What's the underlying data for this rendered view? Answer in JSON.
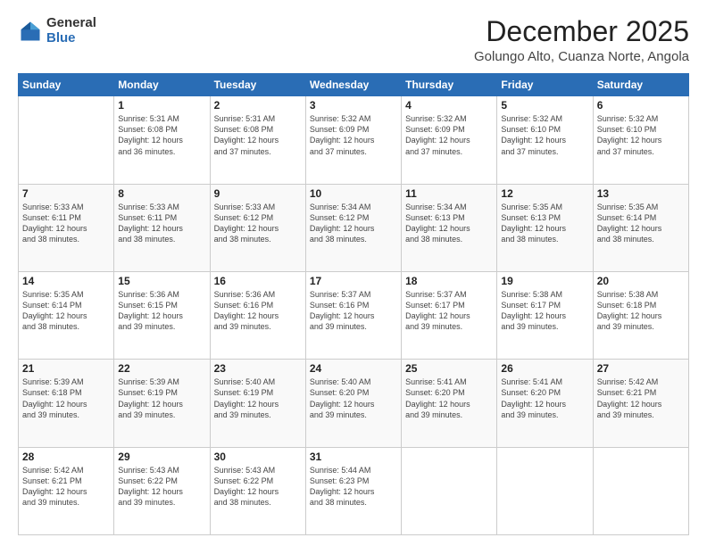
{
  "logo": {
    "general": "General",
    "blue": "Blue"
  },
  "header": {
    "month": "December 2025",
    "location": "Golungo Alto, Cuanza Norte, Angola"
  },
  "weekdays": [
    "Sunday",
    "Monday",
    "Tuesday",
    "Wednesday",
    "Thursday",
    "Friday",
    "Saturday"
  ],
  "weeks": [
    [
      {
        "day": "",
        "info": ""
      },
      {
        "day": "1",
        "info": "Sunrise: 5:31 AM\nSunset: 6:08 PM\nDaylight: 12 hours\nand 36 minutes."
      },
      {
        "day": "2",
        "info": "Sunrise: 5:31 AM\nSunset: 6:08 PM\nDaylight: 12 hours\nand 37 minutes."
      },
      {
        "day": "3",
        "info": "Sunrise: 5:32 AM\nSunset: 6:09 PM\nDaylight: 12 hours\nand 37 minutes."
      },
      {
        "day": "4",
        "info": "Sunrise: 5:32 AM\nSunset: 6:09 PM\nDaylight: 12 hours\nand 37 minutes."
      },
      {
        "day": "5",
        "info": "Sunrise: 5:32 AM\nSunset: 6:10 PM\nDaylight: 12 hours\nand 37 minutes."
      },
      {
        "day": "6",
        "info": "Sunrise: 5:32 AM\nSunset: 6:10 PM\nDaylight: 12 hours\nand 37 minutes."
      }
    ],
    [
      {
        "day": "7",
        "info": "Sunrise: 5:33 AM\nSunset: 6:11 PM\nDaylight: 12 hours\nand 38 minutes."
      },
      {
        "day": "8",
        "info": "Sunrise: 5:33 AM\nSunset: 6:11 PM\nDaylight: 12 hours\nand 38 minutes."
      },
      {
        "day": "9",
        "info": "Sunrise: 5:33 AM\nSunset: 6:12 PM\nDaylight: 12 hours\nand 38 minutes."
      },
      {
        "day": "10",
        "info": "Sunrise: 5:34 AM\nSunset: 6:12 PM\nDaylight: 12 hours\nand 38 minutes."
      },
      {
        "day": "11",
        "info": "Sunrise: 5:34 AM\nSunset: 6:13 PM\nDaylight: 12 hours\nand 38 minutes."
      },
      {
        "day": "12",
        "info": "Sunrise: 5:35 AM\nSunset: 6:13 PM\nDaylight: 12 hours\nand 38 minutes."
      },
      {
        "day": "13",
        "info": "Sunrise: 5:35 AM\nSunset: 6:14 PM\nDaylight: 12 hours\nand 38 minutes."
      }
    ],
    [
      {
        "day": "14",
        "info": "Sunrise: 5:35 AM\nSunset: 6:14 PM\nDaylight: 12 hours\nand 38 minutes."
      },
      {
        "day": "15",
        "info": "Sunrise: 5:36 AM\nSunset: 6:15 PM\nDaylight: 12 hours\nand 39 minutes."
      },
      {
        "day": "16",
        "info": "Sunrise: 5:36 AM\nSunset: 6:16 PM\nDaylight: 12 hours\nand 39 minutes."
      },
      {
        "day": "17",
        "info": "Sunrise: 5:37 AM\nSunset: 6:16 PM\nDaylight: 12 hours\nand 39 minutes."
      },
      {
        "day": "18",
        "info": "Sunrise: 5:37 AM\nSunset: 6:17 PM\nDaylight: 12 hours\nand 39 minutes."
      },
      {
        "day": "19",
        "info": "Sunrise: 5:38 AM\nSunset: 6:17 PM\nDaylight: 12 hours\nand 39 minutes."
      },
      {
        "day": "20",
        "info": "Sunrise: 5:38 AM\nSunset: 6:18 PM\nDaylight: 12 hours\nand 39 minutes."
      }
    ],
    [
      {
        "day": "21",
        "info": "Sunrise: 5:39 AM\nSunset: 6:18 PM\nDaylight: 12 hours\nand 39 minutes."
      },
      {
        "day": "22",
        "info": "Sunrise: 5:39 AM\nSunset: 6:19 PM\nDaylight: 12 hours\nand 39 minutes."
      },
      {
        "day": "23",
        "info": "Sunrise: 5:40 AM\nSunset: 6:19 PM\nDaylight: 12 hours\nand 39 minutes."
      },
      {
        "day": "24",
        "info": "Sunrise: 5:40 AM\nSunset: 6:20 PM\nDaylight: 12 hours\nand 39 minutes."
      },
      {
        "day": "25",
        "info": "Sunrise: 5:41 AM\nSunset: 6:20 PM\nDaylight: 12 hours\nand 39 minutes."
      },
      {
        "day": "26",
        "info": "Sunrise: 5:41 AM\nSunset: 6:20 PM\nDaylight: 12 hours\nand 39 minutes."
      },
      {
        "day": "27",
        "info": "Sunrise: 5:42 AM\nSunset: 6:21 PM\nDaylight: 12 hours\nand 39 minutes."
      }
    ],
    [
      {
        "day": "28",
        "info": "Sunrise: 5:42 AM\nSunset: 6:21 PM\nDaylight: 12 hours\nand 39 minutes."
      },
      {
        "day": "29",
        "info": "Sunrise: 5:43 AM\nSunset: 6:22 PM\nDaylight: 12 hours\nand 39 minutes."
      },
      {
        "day": "30",
        "info": "Sunrise: 5:43 AM\nSunset: 6:22 PM\nDaylight: 12 hours\nand 38 minutes."
      },
      {
        "day": "31",
        "info": "Sunrise: 5:44 AM\nSunset: 6:23 PM\nDaylight: 12 hours\nand 38 minutes."
      },
      {
        "day": "",
        "info": ""
      },
      {
        "day": "",
        "info": ""
      },
      {
        "day": "",
        "info": ""
      }
    ]
  ]
}
